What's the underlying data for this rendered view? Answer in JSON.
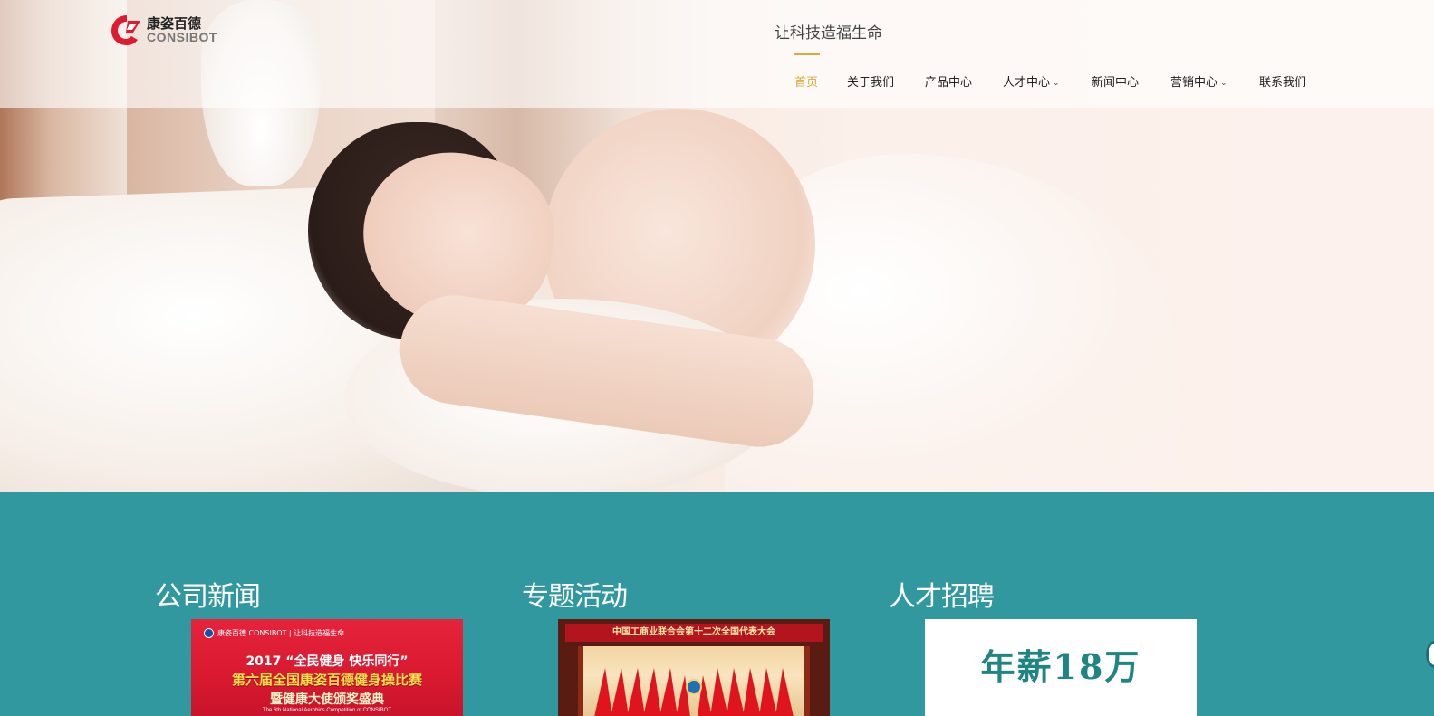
{
  "brand": {
    "name_cn": "康姿百德",
    "name_en": "CONSIBOT",
    "slogan": "让科技造福生命",
    "accent_color": "#e0a93d",
    "logo_color": "#e01b2f"
  },
  "nav": {
    "items": [
      {
        "label": "首页",
        "active": true,
        "has_dropdown": false
      },
      {
        "label": "关于我们",
        "active": false,
        "has_dropdown": false
      },
      {
        "label": "产品中心",
        "active": false,
        "has_dropdown": false
      },
      {
        "label": "人才中心",
        "active": false,
        "has_dropdown": true
      },
      {
        "label": "新闻中心",
        "active": false,
        "has_dropdown": false
      },
      {
        "label": "营销中心",
        "active": false,
        "has_dropdown": true
      },
      {
        "label": "联系我们",
        "active": false,
        "has_dropdown": false
      }
    ],
    "dropdown_icon": "chevron-down-icon"
  },
  "hero": {
    "image": "woman-sleeping-on-pillow"
  },
  "sections": {
    "background_color": "#31989f",
    "columns": [
      {
        "title": "公司新闻",
        "thumb": {
          "header_brand": "康姿百德 CONSIBOT",
          "header_slogan": "让科技造福生命",
          "line1": "2017 “全民健身 快乐同行”",
          "line2": "第六届全国康姿百德健身操比赛",
          "line3": "暨健康大使颁奖盛典",
          "line4": "The 6th National Aerobics Competition of CONSIBOT"
        }
      },
      {
        "title": "专题活动",
        "thumb": {
          "banner": "中国工商业联合会第十二次全国代表大会"
        }
      },
      {
        "title": "人才招聘",
        "thumb": {
          "text": "年薪18万"
        }
      }
    ]
  }
}
